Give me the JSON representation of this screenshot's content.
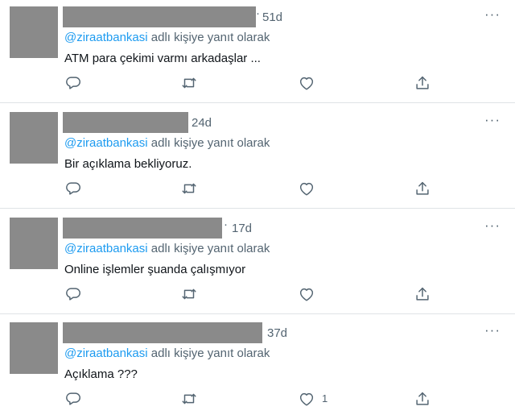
{
  "tweets": [
    {
      "time": "51d",
      "reply_prefix": "@ziraatbankasi",
      "reply_suffix": "adlı kişiye yanıt olarak",
      "text": "ATM para çekimi varmı arkadaşlar ...",
      "like_count": ""
    },
    {
      "time": "24d",
      "reply_prefix": "@ziraatbankasi",
      "reply_suffix": "adlı kişiye yanıt olarak",
      "text": "Bir açıklama bekliyoruz.",
      "like_count": ""
    },
    {
      "time": "17d",
      "reply_prefix": "@ziraatbankasi",
      "reply_suffix": "adlı kişiye yanıt olarak",
      "text": "Online işlemler şuanda çalışmıyor",
      "like_count": ""
    },
    {
      "time": "37d",
      "reply_prefix": "@ziraatbankasi",
      "reply_suffix": "adlı kişiye yanıt olarak",
      "text": "Açıklama ???",
      "like_count": "1"
    }
  ],
  "more_glyph": "···",
  "colors": {
    "link": "#1d9bf0",
    "muted": "#536471",
    "redaction": "#8a8a8a",
    "divider": "#dfe3e6"
  },
  "icons": [
    "reply-icon",
    "retweet-icon",
    "like-icon",
    "share-icon"
  ]
}
